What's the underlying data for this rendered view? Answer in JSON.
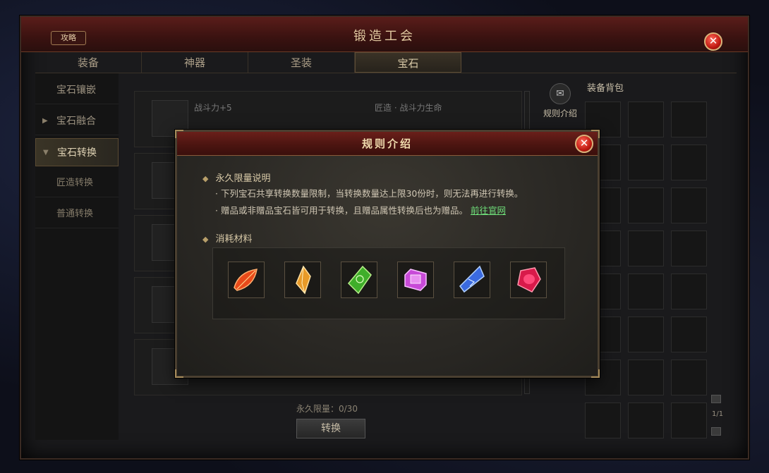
{
  "window": {
    "title": "锻造工会",
    "guide_label": "攻略",
    "close_label": "✕"
  },
  "tabs": [
    {
      "label": "装备"
    },
    {
      "label": "神器"
    },
    {
      "label": "圣装"
    },
    {
      "label": "宝石"
    }
  ],
  "sidebar": {
    "items": [
      {
        "label": "宝石镶嵌"
      },
      {
        "label": "宝石融合"
      },
      {
        "label": "宝石转换"
      },
      {
        "label": "匠造转换"
      },
      {
        "label": "普通转换"
      }
    ]
  },
  "content": {
    "row1_text": "战斗力+5",
    "row1_target": "匠造 · 战斗力生命",
    "permanent_limit": "永久限量：0/30",
    "convert_button": "转换"
  },
  "rules_button": {
    "label": "规则介绍"
  },
  "bag": {
    "title": "装备背包",
    "page": "1/1"
  },
  "dialog": {
    "title": "规则介绍",
    "close_label": "✕",
    "section1_title": "永久限量说明",
    "line1": "· 下列宝石共享转换数量限制，当转换数量达上限30份时，则无法再进行转换。",
    "line2_text": "· 赠品或非赠品宝石皆可用于转换，且赠品属性转换后也为赠品。",
    "line2_link": "前往官网",
    "section2_title": "消耗材料",
    "materials": [
      {
        "icon": "red-leaf-gem-icon",
        "color": "#e84a1a"
      },
      {
        "icon": "amber-gem-icon",
        "color": "#e89a28"
      },
      {
        "icon": "green-gem-icon",
        "color": "#3fae2a"
      },
      {
        "icon": "purple-gem-icon",
        "color": "#c84ad8"
      },
      {
        "icon": "blue-gem-icon",
        "color": "#3a6ae0"
      },
      {
        "icon": "ruby-gem-icon",
        "color": "#d81a4a"
      }
    ]
  }
}
